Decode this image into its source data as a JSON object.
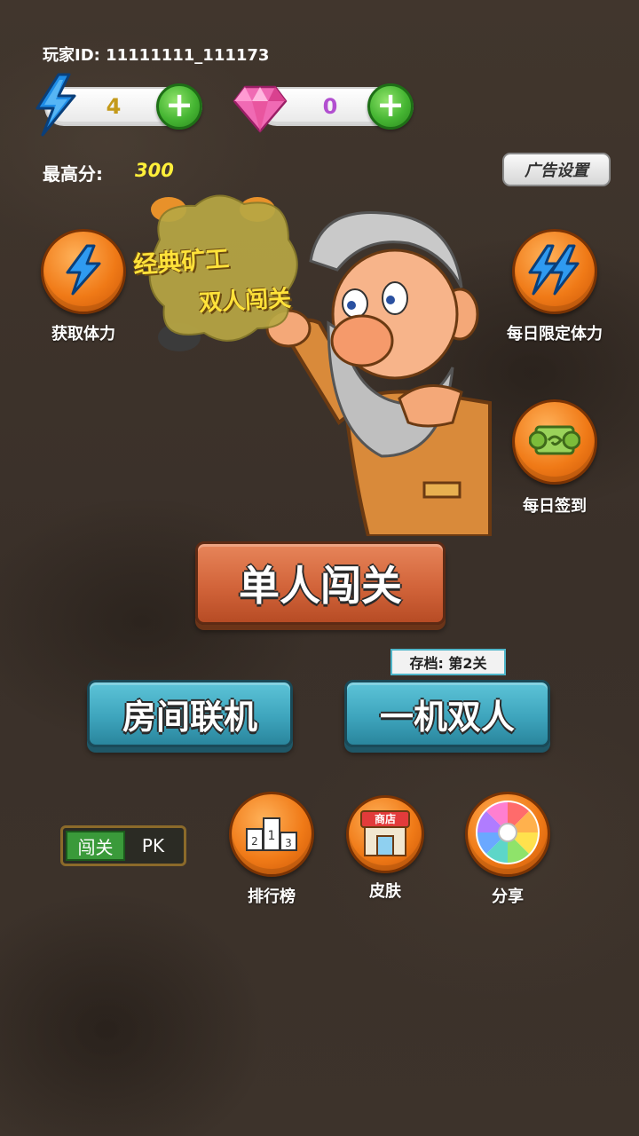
{
  "player": {
    "id_text": "玩家ID: 11111111_111173"
  },
  "resources": {
    "energy": {
      "icon": "lightning-icon",
      "value": "4"
    },
    "gems": {
      "icon": "gem-icon",
      "value": "0"
    }
  },
  "high_score": {
    "label": "最高分:",
    "value": "300"
  },
  "ad_settings_label": "广告设置",
  "logo_text": {
    "line1": "经典矿工",
    "line2": "双人闯关"
  },
  "side_buttons": {
    "get_energy": {
      "label": "获取体力",
      "icon": "lightning-icon"
    },
    "daily_energy": {
      "label": "每日限定体力",
      "icon": "double-lightning-icon"
    },
    "daily_signin": {
      "label": "每日签到",
      "icon": "scroll-icon"
    }
  },
  "main_buttons": {
    "single": "单人闯关",
    "room_online": "房间联机",
    "two_player": "一机双人"
  },
  "save_tag": "存档: 第2关",
  "mode_toggle": {
    "on": "闯关",
    "off": "PK"
  },
  "bottom_buttons": {
    "leaderboard": {
      "label": "排行榜",
      "icon": "podium-icon"
    },
    "skins": {
      "label": "皮肤",
      "icon": "shop-icon",
      "badge": "商店"
    },
    "share": {
      "label": "分享",
      "icon": "wheel-icon"
    }
  },
  "colors": {
    "background": "#3f352d",
    "accent_orange": "#f07a17",
    "accent_green": "#45b532",
    "score_yellow": "#ffef3a",
    "stone_blue": "#3ea5bd",
    "stone_orange": "#d2643a"
  }
}
